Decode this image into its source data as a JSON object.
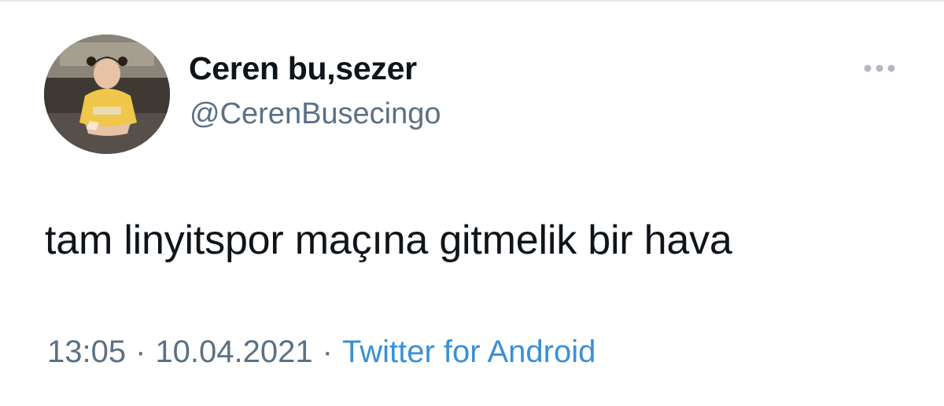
{
  "tweet": {
    "display_name": "Ceren bu,sezer",
    "handle": "@CerenBusecingo",
    "text": "tam linyitspor maçına gitmelik bir hava",
    "time": "13:05",
    "date": "10.04.2021",
    "separator": "·",
    "source": "Twitter for Android"
  },
  "icons": {
    "more": "more-options-icon",
    "avatar": "profile-avatar-image"
  },
  "colors": {
    "text_primary": "#0f1419",
    "text_secondary": "#5b7083",
    "link": "#3b8fd6",
    "icon_gray": "#b3b9bf"
  }
}
